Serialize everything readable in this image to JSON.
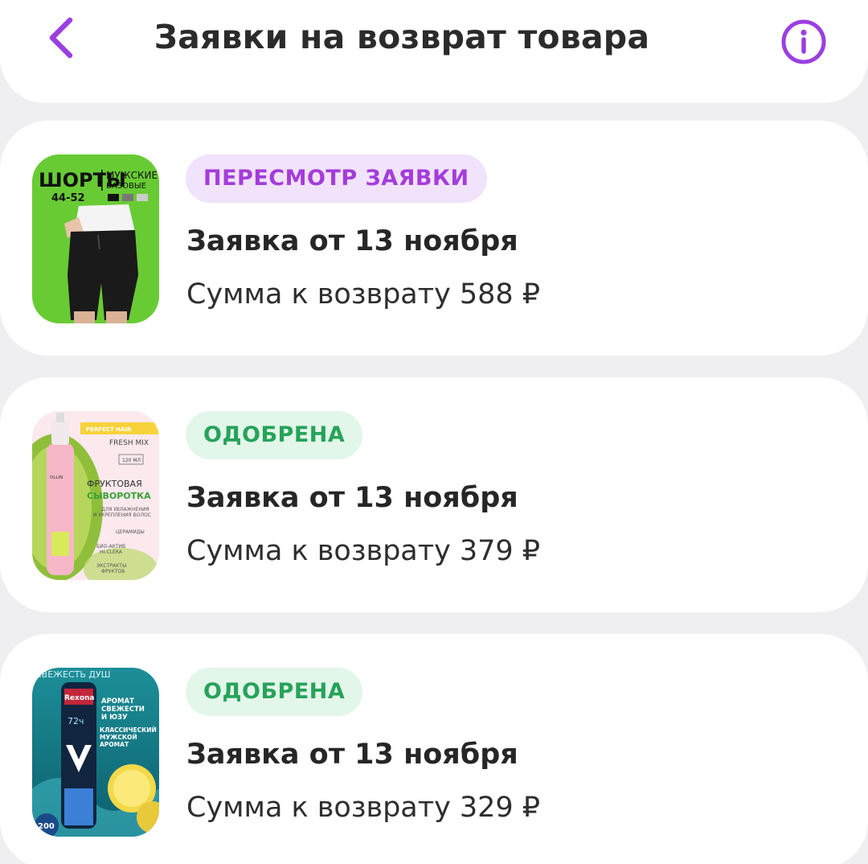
{
  "header": {
    "title": "Заявки на возврат товара",
    "back_icon": "chevron-left-icon",
    "info_icon": "info-circle-icon",
    "accent_color": "#9b3fe0"
  },
  "requests": [
    {
      "status": "ПЕРЕСМОТР ЗАЯВКИ",
      "status_type": "review",
      "title": "Заявка от 13 ноября",
      "amount_label": "Сумма к возврату",
      "amount": "588 ₽",
      "product_image": {
        "lines": [
          "ШОРТЫ",
          "МУЖСКИЕ",
          "БАЗОВЫЕ",
          "44-52"
        ]
      }
    },
    {
      "status": "ОДОБРЕНА",
      "status_type": "approved",
      "title": "Заявка от 13 ноября",
      "amount_label": "Сумма к возврату",
      "amount": "379 ₽",
      "product_image": {
        "lines": [
          "PERFECT HAIR",
          "FRESH MIX",
          "120 МЛ",
          "ФРУКТОВАЯ",
          "СЫВОРОТКА",
          "ДЛЯ УВЛАЖНЕНИЯ",
          "И УКРЕПЛЕНИЯ ВОЛОС",
          "ЦЕРАМИДЫ",
          "БИО-АКТИВ",
          "HI-CLERA",
          "ЭКСТРАКТЫ",
          "ФРУКТОВ",
          "OLLIN"
        ]
      }
    },
    {
      "status": "ОДОБРЕНА",
      "status_type": "approved",
      "title": "Заявка от 13 ноября",
      "amount_label": "Сумма к возврату",
      "amount": "329 ₽",
      "product_image": {
        "lines": [
          "СВЕЖЕСТЬ ДУШ",
          "АРОМАТ",
          "СВЕЖЕСТИ",
          "И ЮЗУ",
          "КЛАССИЧЕСКИЙ",
          "МУЖСКОЙ",
          "АРОМАТ",
          "Rexona",
          "72ч",
          "200"
        ]
      }
    }
  ],
  "colors": {
    "review_badge_bg": "#f1e3fb",
    "review_badge_text": "#a43cdb",
    "approved_badge_bg": "#e3f6ea",
    "approved_badge_text": "#26a35a"
  }
}
